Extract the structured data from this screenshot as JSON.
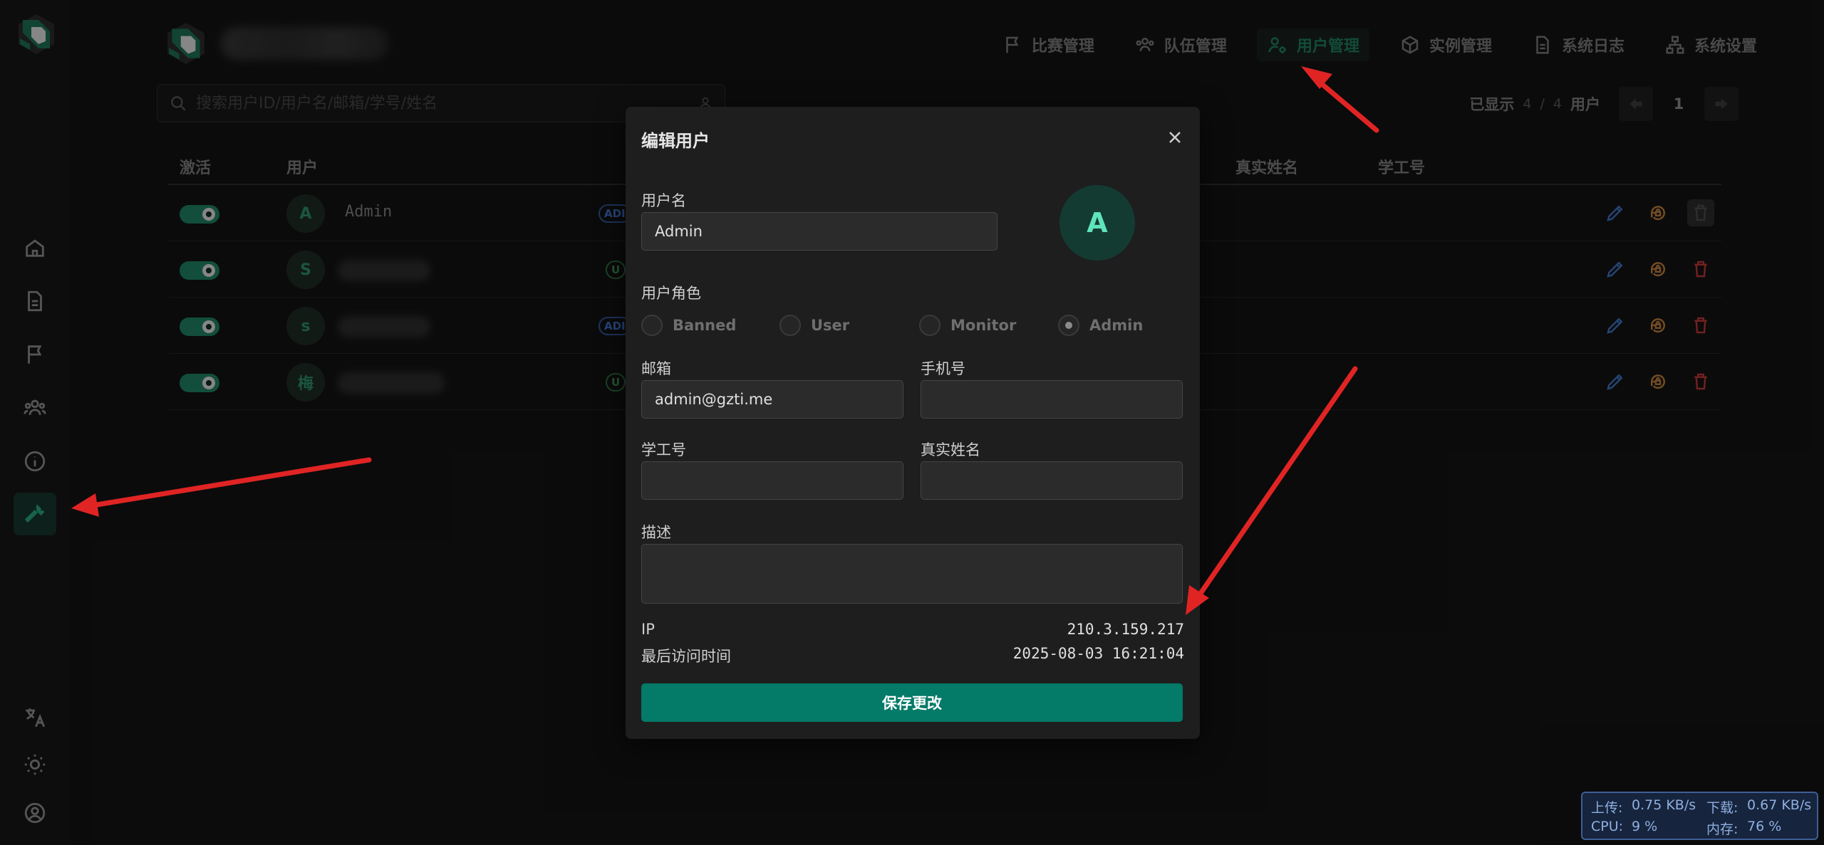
{
  "nav": {
    "items": [
      {
        "label": "比赛管理",
        "icon": "flag-icon"
      },
      {
        "label": "队伍管理",
        "icon": "team-icon"
      },
      {
        "label": "用户管理",
        "icon": "user-gear-icon"
      },
      {
        "label": "实例管理",
        "icon": "cube-icon"
      },
      {
        "label": "系统日志",
        "icon": "document-icon"
      },
      {
        "label": "系统设置",
        "icon": "sitemap-icon"
      }
    ],
    "active": "用户管理"
  },
  "sidebar": {
    "items": [
      "home-icon",
      "document-icon",
      "flag-icon",
      "team-icon",
      "info-icon",
      "wrench-icon"
    ],
    "active": "wrench-icon",
    "bottom": [
      "translate-icon",
      "theme-icon",
      "user-circle-icon"
    ]
  },
  "search": {
    "placeholder": "搜索用户ID/用户名/邮箱/学号/姓名"
  },
  "pager": {
    "shown_label": "已显示",
    "shown": "4",
    "sep": "/",
    "total": "4",
    "unit": "用户",
    "page": "1"
  },
  "table": {
    "headers": {
      "active": "激活",
      "user": "用户",
      "realname": "真实姓名",
      "student_id": "学工号"
    },
    "rows": [
      {
        "avatar": "A",
        "name": "Admin",
        "role_tag": "ADI"
      },
      {
        "avatar": "S",
        "name": "",
        "role_tag": "U"
      },
      {
        "avatar": "s",
        "name": "",
        "role_tag": "ADI"
      },
      {
        "avatar": "梅",
        "name": "",
        "role_tag": "U"
      }
    ]
  },
  "modal": {
    "title": "编辑用户",
    "username_label": "用户名",
    "username": "Admin",
    "avatar_letter": "A",
    "role_label": "用户角色",
    "roles": [
      "Banned",
      "User",
      "Monitor",
      "Admin"
    ],
    "selected_role": "Admin",
    "email_label": "邮箱",
    "email": "admin@gzti.me",
    "phone_label": "手机号",
    "phone": "",
    "student_label": "学工号",
    "student": "",
    "realname_label": "真实姓名",
    "realname": "",
    "desc_label": "描述",
    "desc": "",
    "ip_label": "IP",
    "ip": "210.3.159.217",
    "last_visit_label": "最后访问时间",
    "last_visit": "2025-08-03 16:21:04",
    "save_label": "保存更改"
  },
  "sysmon": {
    "upload_label": "上传:",
    "upload": "0.75 KB/s",
    "download_label": "下载:",
    "download": "0.67 KB/s",
    "cpu_label": "CPU:",
    "cpu": "9 %",
    "mem_label": "内存:",
    "mem": "76 %"
  },
  "colors": {
    "accent": "#047a68",
    "nav_active": "#1d7a5c",
    "arrow": "#e02424",
    "modal_bg": "#1e1e1e",
    "page_bg": "#131313"
  }
}
